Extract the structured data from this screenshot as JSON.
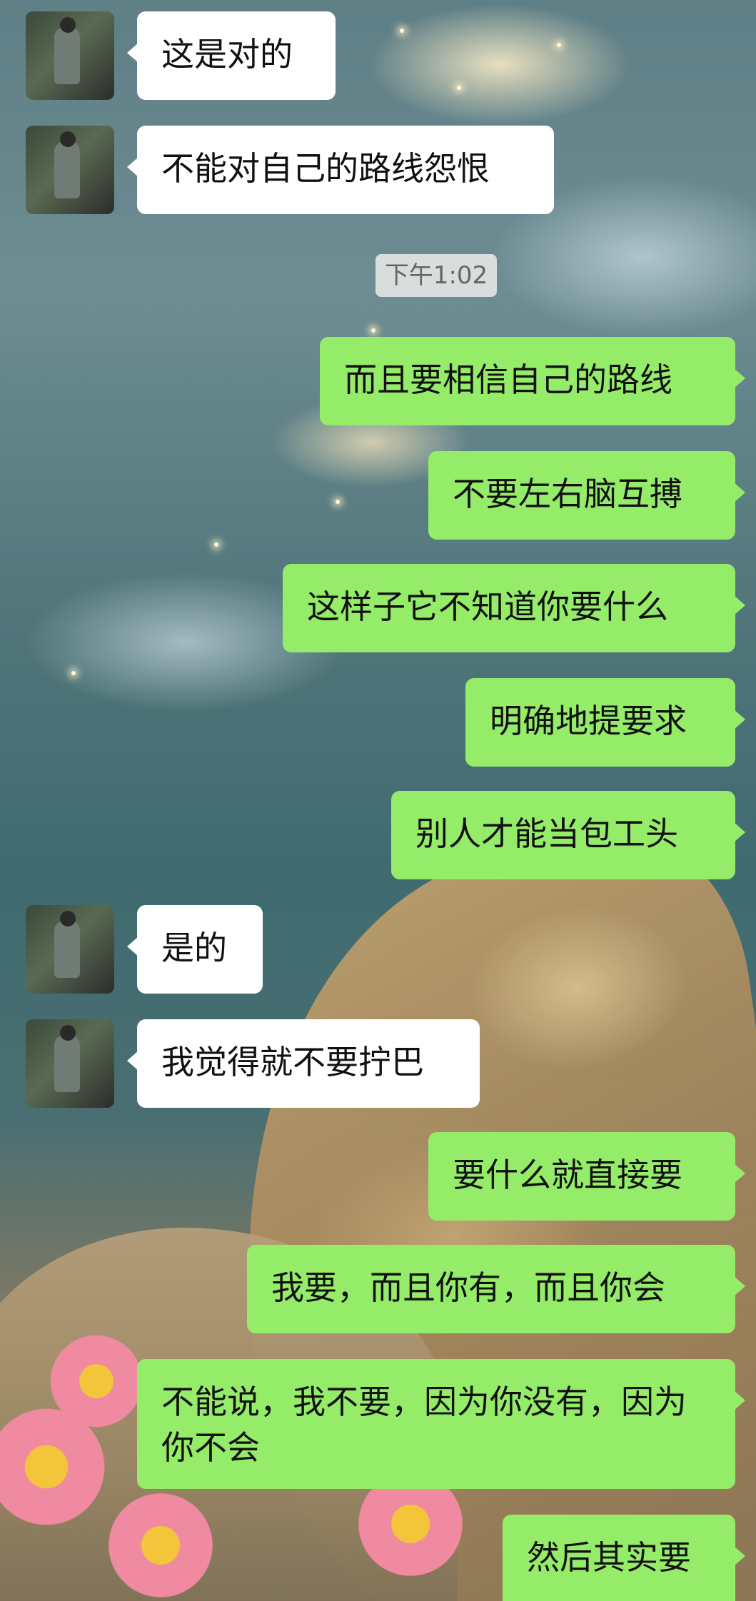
{
  "chat": {
    "messages": [
      {
        "side": "left",
        "text": "这是对的"
      },
      {
        "side": "left",
        "text": "不能对自己的路线怨恨"
      },
      {
        "side": "time",
        "text": "下午1:02"
      },
      {
        "side": "right",
        "text": "而且要相信自己的路线"
      },
      {
        "side": "right",
        "text": "不要左右脑互搏"
      },
      {
        "side": "right",
        "text": "这样子它不知道你要什么"
      },
      {
        "side": "right",
        "text": "明确地提要求"
      },
      {
        "side": "right",
        "text": "别人才能当包工头"
      },
      {
        "side": "left",
        "text": "是的"
      },
      {
        "side": "left",
        "text": "我觉得就不要拧巴"
      },
      {
        "side": "right",
        "text": "要什么就直接要"
      },
      {
        "side": "right",
        "text": "我要，而且你有，而且你会"
      },
      {
        "side": "right",
        "text": "不能说，我不要，因为你没有，因为你不会"
      },
      {
        "side": "right",
        "text": "然后其实要"
      }
    ]
  },
  "colors": {
    "outgoing_bubble": "#95ec69",
    "incoming_bubble": "#ffffff",
    "timestamp_bg": "#ebebeb"
  },
  "icons": {
    "avatar": "contact-avatar-photo"
  }
}
